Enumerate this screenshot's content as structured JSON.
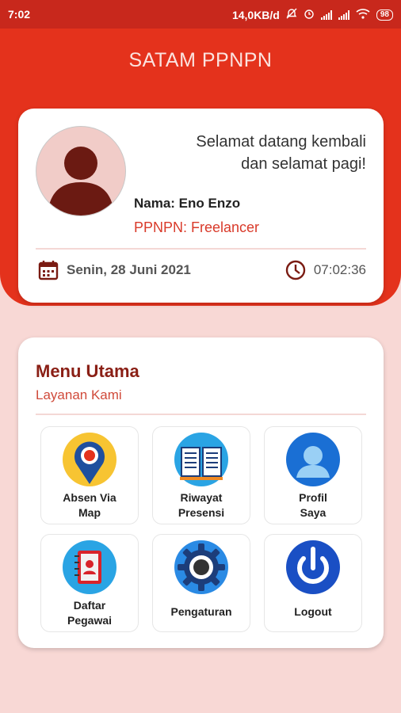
{
  "status_bar": {
    "time": "7:02",
    "speed": "14,0KB/d",
    "battery": "98"
  },
  "header": {
    "title": "SATAM PPNPN"
  },
  "welcome": {
    "greeting_line1": "Selamat datang kembali",
    "greeting_line2": "dan selamat pagi!",
    "name": "Nama: Eno Enzo",
    "role": "PPNPN: Freelancer",
    "date": "Senin, 28 Juni 2021",
    "clock": "07:02:36"
  },
  "menu": {
    "title": "Menu Utama",
    "subtitle": "Layanan Kami",
    "items": [
      {
        "line1": "Absen Via",
        "line2": "Map",
        "icon": "map-pin-icon"
      },
      {
        "line1": "Riwayat",
        "line2": "Presensi",
        "icon": "book-icon"
      },
      {
        "line1": "Profil",
        "line2": "Saya",
        "icon": "profile-icon"
      },
      {
        "line1": "Daftar",
        "line2": "Pegawai",
        "icon": "contacts-book-icon"
      },
      {
        "line1": "Pengaturan",
        "line2": "",
        "icon": "gear-icon"
      },
      {
        "line1": "Logout",
        "line2": "",
        "icon": "power-icon"
      }
    ]
  },
  "colors": {
    "primary": "#e4321c",
    "background": "#f8d8d5",
    "accent": "#d93a2a"
  }
}
